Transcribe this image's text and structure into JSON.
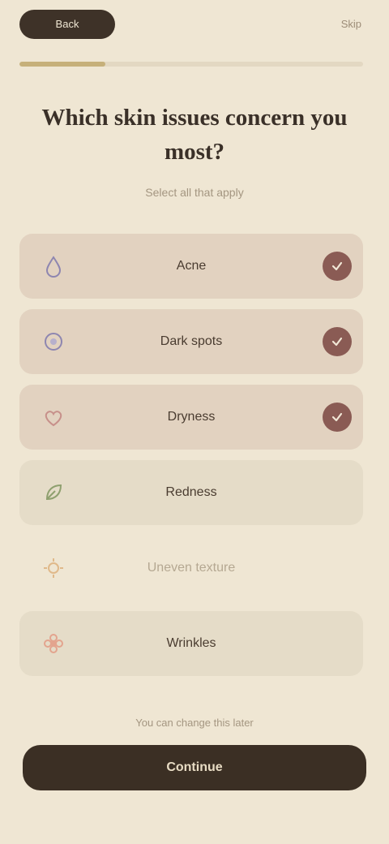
{
  "header": {
    "back_label": "Back",
    "top_link": "Skip",
    "progress_fraction": 0.25
  },
  "title": "Which skin issues concern you most?",
  "subtitle": "Select all that apply",
  "options": [
    {
      "label": "Acne",
      "selected": true,
      "icon": "droplet-icon"
    },
    {
      "label": "Dark spots",
      "selected": true,
      "icon": "circle-icon"
    },
    {
      "label": "Dryness",
      "selected": true,
      "icon": "heart-icon"
    },
    {
      "label": "Redness",
      "selected": false,
      "icon": "leaf-icon"
    },
    {
      "label": "Uneven texture",
      "selected": false,
      "icon": "sun-icon"
    },
    {
      "label": "Wrinkles",
      "selected": false,
      "icon": "flower-icon"
    }
  ],
  "footer_note": "You can change this later",
  "cta_label": "Continue",
  "colors": {
    "background": "#efe6d3",
    "selected_row": "#e2d2c0",
    "check": "#8a5b54",
    "cta": "#3b2f24"
  }
}
